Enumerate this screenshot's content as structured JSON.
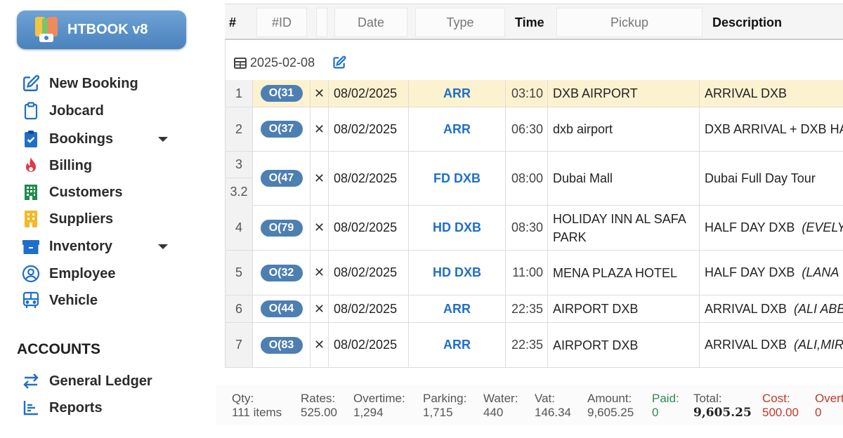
{
  "app": {
    "name": "HTBOOK v8"
  },
  "nav": [
    {
      "label": "New Booking",
      "icon": "edit-icon"
    },
    {
      "label": "Jobcard",
      "icon": "clipboard-icon"
    },
    {
      "label": "Bookings",
      "icon": "clipboard-check-icon",
      "has_dropdown": true
    },
    {
      "label": "Billing",
      "icon": "fire-icon"
    },
    {
      "label": "Customers",
      "icon": "building-icon"
    },
    {
      "label": "Suppliers",
      "icon": "office-building-icon"
    },
    {
      "label": "Inventory",
      "icon": "box-icon",
      "has_dropdown": true
    },
    {
      "label": "Employee",
      "icon": "user-circle-icon"
    },
    {
      "label": "Vehicle",
      "icon": "bus-icon"
    }
  ],
  "accounts": {
    "title": "ACCOUNTS",
    "items": [
      {
        "label": "General Ledger",
        "icon": "exchange-icon"
      },
      {
        "label": "Reports",
        "icon": "bar-chart-icon"
      }
    ]
  },
  "table": {
    "headers": {
      "num": "#",
      "id": "#ID",
      "date": "Date",
      "type": "Type",
      "time": "Time",
      "pickup": "Pickup",
      "description": "Description"
    },
    "group_date": "2025-02-08",
    "rows": [
      {
        "num": "1",
        "id": "O(31",
        "date": "08/02/2025",
        "type": "ARR",
        "time": "03:10",
        "pickup": "DXB AIRPORT",
        "desc": "ARRIVAL DXB",
        "note": ""
      },
      {
        "num": "2",
        "id": "O(37",
        "date": "08/02/2025",
        "type": "ARR",
        "time": "06:30",
        "pickup": "dxb airport",
        "desc": "DXB ARRIVAL + DXB HA",
        "note": ""
      },
      {
        "num": "3",
        "num_sub": "3.2",
        "id": "O(47",
        "date": "08/02/2025",
        "type": "FD DXB",
        "time": "08:00",
        "pickup": "Dubai Mall",
        "desc": "Dubai Full Day Tour",
        "note": ""
      },
      {
        "num": "4",
        "id": "O(79",
        "date": "08/02/2025",
        "type": "HD DXB",
        "time": "08:30",
        "pickup": "HOLIDAY INN AL SAFA PARK",
        "desc": "HALF DAY DXB",
        "note": "(EVELYI"
      },
      {
        "num": "5",
        "id": "O(32",
        "date": "08/02/2025",
        "type": "HD DXB",
        "time": "11:00",
        "pickup": "MENA PLAZA HOTEL",
        "desc": "HALF DAY DXB",
        "note": "(LANA"
      },
      {
        "num": "6",
        "id": "O(44",
        "date": "08/02/2025",
        "type": "ARR",
        "time": "22:35",
        "pickup": "AIRPORT DXB",
        "desc": "ARRIVAL DXB",
        "note": "(ALI ABB"
      },
      {
        "num": "7",
        "id": "O(83",
        "date": "08/02/2025",
        "type": "ARR",
        "time": "22:35",
        "pickup": "AIRPORT DXB",
        "desc": "ARRIVAL DXB",
        "note": "(ALI,MIR"
      }
    ]
  },
  "footer": [
    {
      "label": "Qty:",
      "value": "111 items"
    },
    {
      "label": "Rates:",
      "value": "525.00"
    },
    {
      "label": "Overtime:",
      "value": "1,294"
    },
    {
      "label": "Parking:",
      "value": "1,715"
    },
    {
      "label": "Water:",
      "value": "440"
    },
    {
      "label": "Vat:",
      "value": "146.34"
    },
    {
      "label": "Amount:",
      "value": "9,605.25"
    },
    {
      "label": "Paid:",
      "value": "0"
    },
    {
      "label": "Total:",
      "value": "9,605.25"
    },
    {
      "label": "Cost:",
      "value": "500.00"
    },
    {
      "label": "Overt",
      "value": "0"
    }
  ],
  "colors": {
    "brand": "#5a91c9",
    "accent": "#1f6fc9",
    "highlight_row": "#fdf2cf",
    "paid": "#2e8b57",
    "cost": "#c0392b"
  }
}
